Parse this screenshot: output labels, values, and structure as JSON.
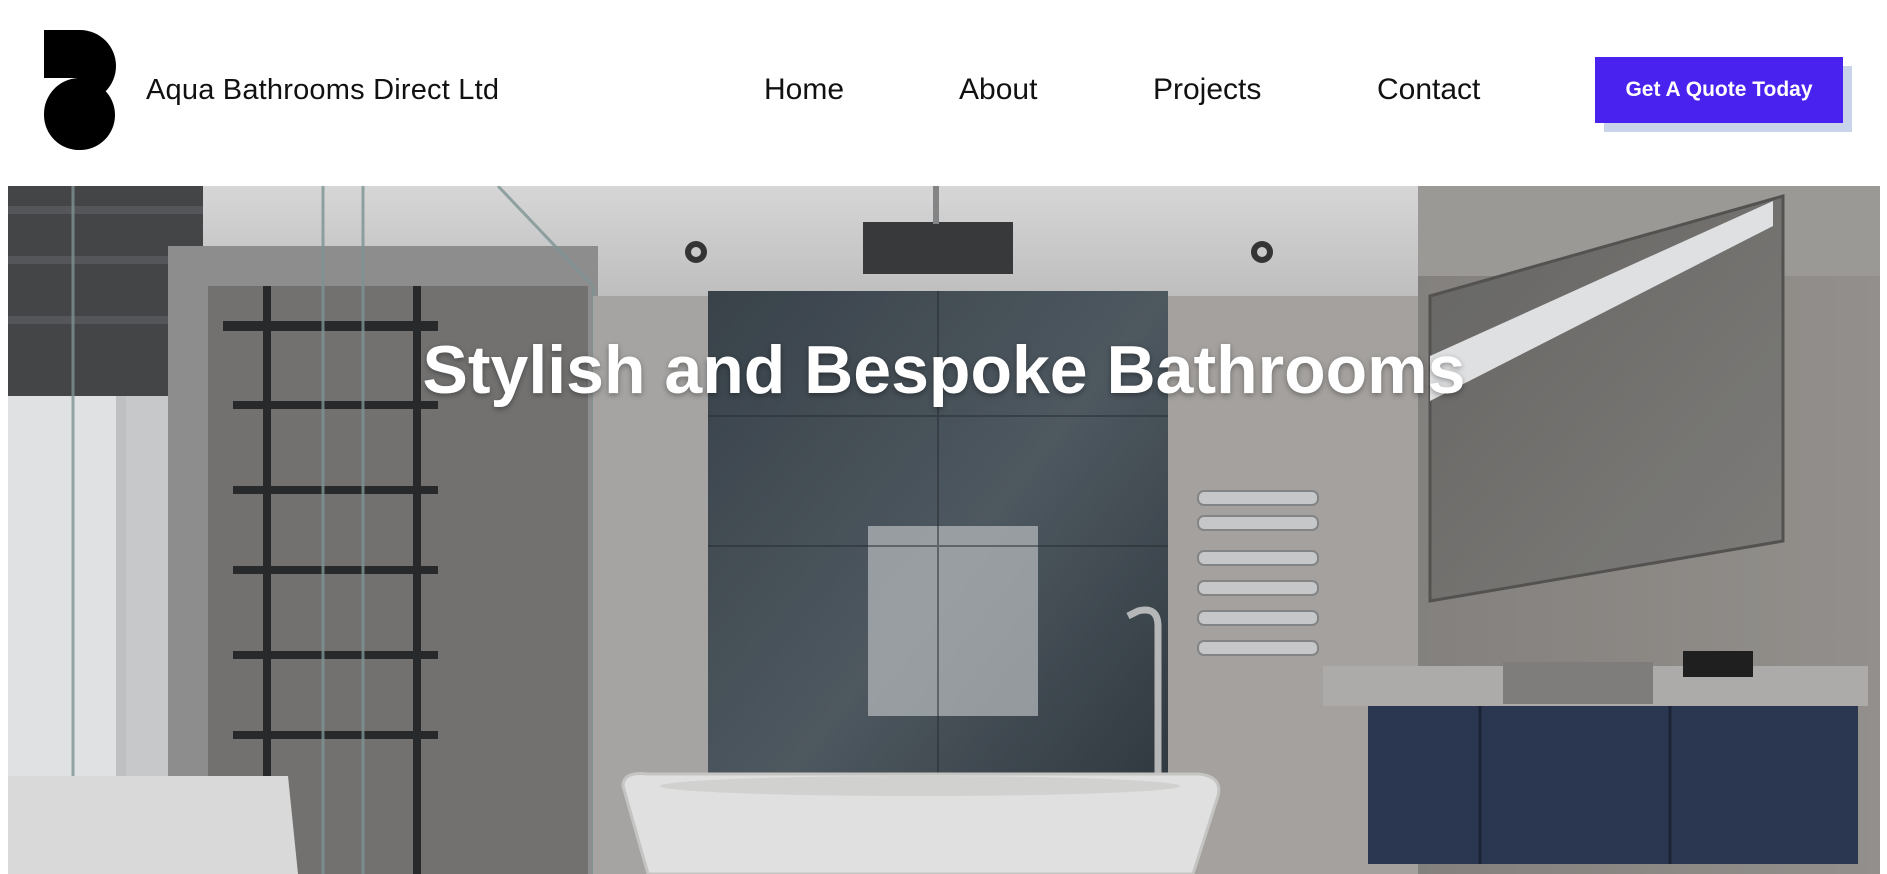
{
  "brand": {
    "name": "Aqua Bathrooms Direct Ltd",
    "logo_icon": "b-letter-logo"
  },
  "nav": {
    "items": [
      "Home",
      "About",
      "Projects",
      "Contact"
    ]
  },
  "cta": {
    "label": "Get A Quote Today"
  },
  "hero": {
    "title": "Stylish and Bespoke Bathrooms"
  },
  "colors": {
    "accent": "#4a22f0",
    "cta_shadow": "#c9d3ea"
  }
}
